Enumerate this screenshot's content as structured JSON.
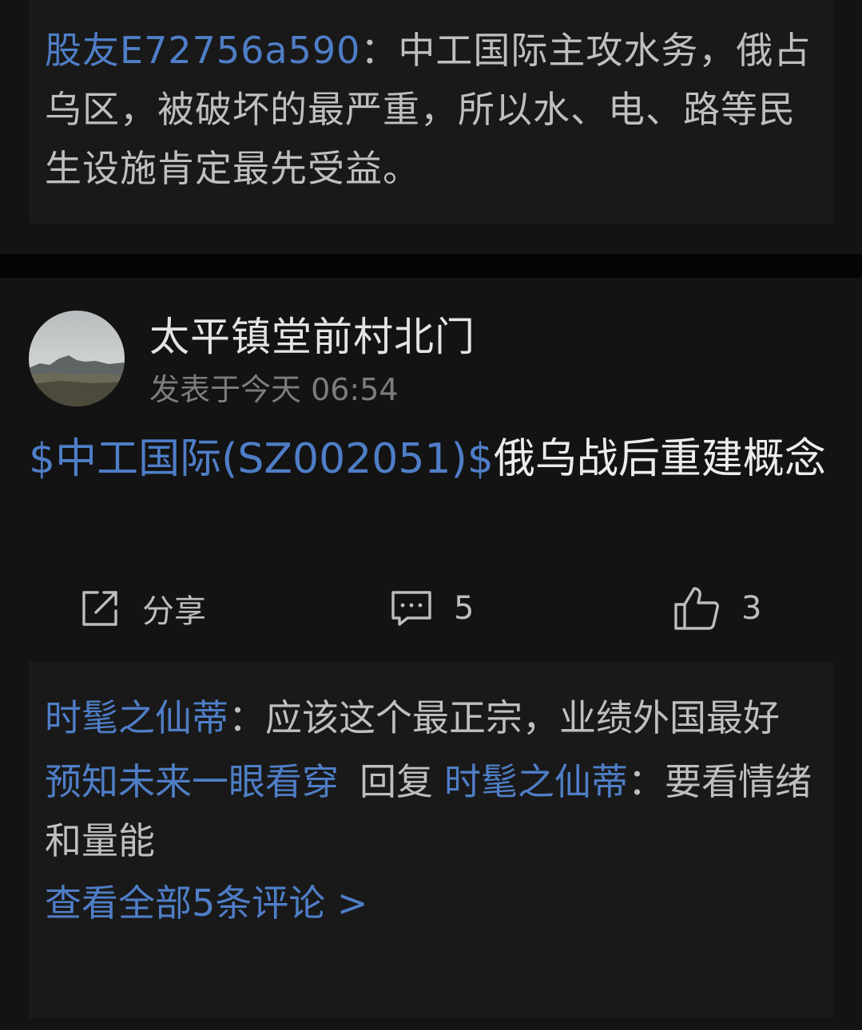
{
  "top_comment": {
    "user": "股友E72756a590",
    "separator": "：",
    "text": "中工国际主攻水务，俄占乌区，被破坏的最严重，所以水、电、路等民生设施肯定最先受益。"
  },
  "post": {
    "author": "太平镇堂前村北门",
    "time": "发表于今天 06:54",
    "stock_tag": "$中工国际(SZ002051)$",
    "text": "俄乌战后重建概念"
  },
  "actions": {
    "share_label": "分享",
    "comment_count": "5",
    "like_count": "3"
  },
  "comments": {
    "first": {
      "user": "时髦之仙蒂",
      "separator": "：",
      "text": "应该这个最正宗，业绩外国最好"
    },
    "second": {
      "user": "预知未来一眼看穿",
      "reply_word": "回复",
      "reply_to": "时髦之仙蒂",
      "separator": "：",
      "text": "要看情绪和量能"
    },
    "view_all": "查看全部5条评论 >"
  },
  "colors": {
    "background": "#131313",
    "card": "#191919",
    "link": "#4f7ec7",
    "text": "#bfbfbf"
  }
}
